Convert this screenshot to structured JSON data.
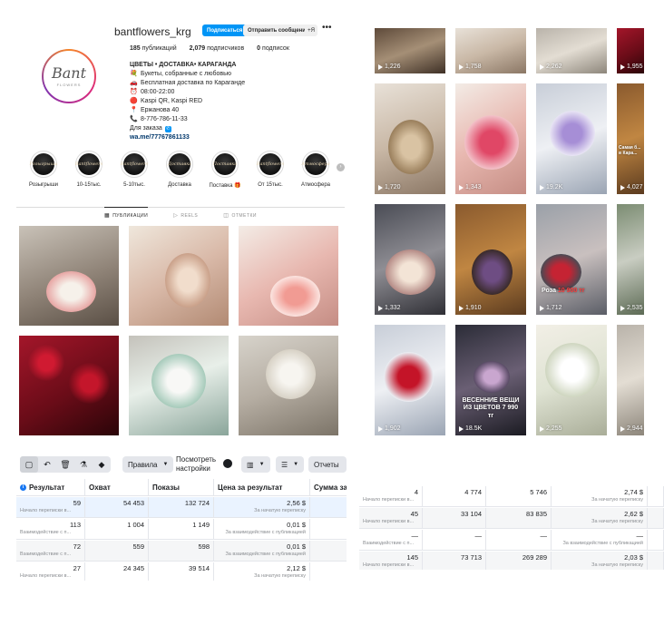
{
  "profile": {
    "username": "bantflowers_krg",
    "follow_label": "Подписаться",
    "message_label": "Отправить сообщение",
    "add_label": "+Я",
    "more_label": "•••",
    "logo_word": "Bant",
    "logo_sub": "FLOWERS",
    "stats": {
      "posts_count": "185",
      "posts_label": "публикаций",
      "followers_count": "2,079",
      "followers_label": "подписчиков",
      "following_count": "0",
      "following_label": "подписок"
    },
    "bio": {
      "name": "ЦВЕТЫ • ДОСТАВКА• КАРАГАНДА",
      "lines": [
        {
          "emoji": "💐",
          "text": "Букеты, собранные с любовью"
        },
        {
          "emoji": "🚗",
          "text": "Бесплатная доставка по Караганде"
        },
        {
          "emoji": "⏰",
          "text": "08:00-22:00"
        },
        {
          "emoji": "🔴",
          "text": "Kaspi QR, Kaspi RED"
        },
        {
          "emoji": "📍",
          "text": "Ержанова 40"
        },
        {
          "emoji": "📞",
          "text": "8-776-786-11-33"
        },
        {
          "emoji": "",
          "text": "Для заказа"
        }
      ],
      "link": "wa.me/77767861133"
    },
    "highlights": [
      {
        "cover": "Розыгрыши",
        "label": "Розыгрыши"
      },
      {
        "cover": "Bantflowers",
        "label": "10-15тыс."
      },
      {
        "cover": "Bantflowers",
        "label": "5-10тыс."
      },
      {
        "cover": "Доставка",
        "label": "Доставка"
      },
      {
        "cover": "Поставка",
        "label": "Поставка 🎁"
      },
      {
        "cover": "Bantflowers",
        "label": "От 15тыс."
      },
      {
        "cover": "Атмосфера",
        "label": "Атмосфера"
      }
    ],
    "tabs": [
      {
        "icon": "▦",
        "label": "ПУБЛИКАЦИИ"
      },
      {
        "icon": "▷",
        "label": "REELS"
      },
      {
        "icon": "◫",
        "label": "ОТМЕТКИ"
      }
    ]
  },
  "reels": {
    "views": [
      "1,226",
      "1,758",
      "2,262",
      "1,955",
      "1,720",
      "1,343",
      "19.2K",
      "4,027",
      "1,332",
      "1,910",
      "1,712",
      "2,535",
      "1,902",
      "18.5K",
      "2,255",
      "2,944"
    ],
    "caption_cell_5": "Самая б... в Кара...",
    "caption_cell_13": "ВЕСЕННИЕ ВЕЩИ ИЗ ЦВЕТОВ 7 990 тг",
    "price_cell_10": "10 900 тг",
    "price_prefix_cell_10": "Роза "
  },
  "ads": {
    "toolbar": {
      "rules_label": "Правила",
      "view_settings_label": "Посмотреть настройки",
      "reports_label": "Отчеты"
    },
    "columns": [
      "Результат",
      "Охват",
      "Показы",
      "Цена за результат",
      "Сумма за"
    ],
    "rows_left": [
      {
        "result": "59",
        "result_sub": "Начало переписки в...",
        "reach": "54 453",
        "impressions": "132 724",
        "cost": "2,56 $",
        "cost_sub": "За начатую переписку"
      },
      {
        "result": "113",
        "result_sub": "Взаимодействие с п...",
        "reach": "1 004",
        "impressions": "1 149",
        "cost": "0,01 $",
        "cost_sub": "За взаимодействие с публикацией"
      },
      {
        "result": "72",
        "result_sub": "Взаимодействие с п...",
        "reach": "559",
        "impressions": "598",
        "cost": "0,01 $",
        "cost_sub": "За взаимодействие с публикацией"
      },
      {
        "result": "27",
        "result_sub": "Начало переписки в...",
        "reach": "24 345",
        "impressions": "39 514",
        "cost": "2,12 $",
        "cost_sub": "За начатую переписку"
      }
    ],
    "rows_right": [
      {
        "result": "4",
        "result_sub": "Начало переписки в...",
        "reach": "4 774",
        "impressions": "5 746",
        "cost": "2,74 $",
        "cost_sub": "За начатую переписку"
      },
      {
        "result": "45",
        "result_sub": "Начало переписки в...",
        "reach": "33 104",
        "impressions": "83 835",
        "cost": "2,62 $",
        "cost_sub": "За начатую переписку"
      },
      {
        "result": "—",
        "result_sub": "Взаимодействие с п...",
        "reach": "—",
        "impressions": "—",
        "cost": "—",
        "cost_sub": "За взаимодействие с публикацией"
      },
      {
        "result": "145",
        "result_sub": "Начало переписки в...",
        "reach": "73 713",
        "impressions": "269 289",
        "cost": "2,03 $",
        "cost_sub": "За начатую переписку"
      }
    ]
  }
}
